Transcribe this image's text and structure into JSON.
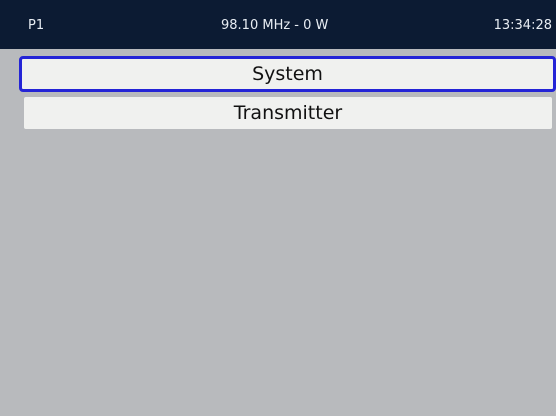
{
  "status_bar": {
    "preset": "P1",
    "frequency_power": "98.10 MHz - 0 W",
    "time": "13:34:28"
  },
  "menu": {
    "selected_index": 0,
    "items": [
      {
        "label": "System"
      },
      {
        "label": "Transmitter"
      }
    ]
  },
  "colors": {
    "status_bar_bg": "#0c1b33",
    "screen_bg": "#b8babd",
    "item_bg": "#f0f1ef",
    "selection_border": "#2424d6"
  }
}
